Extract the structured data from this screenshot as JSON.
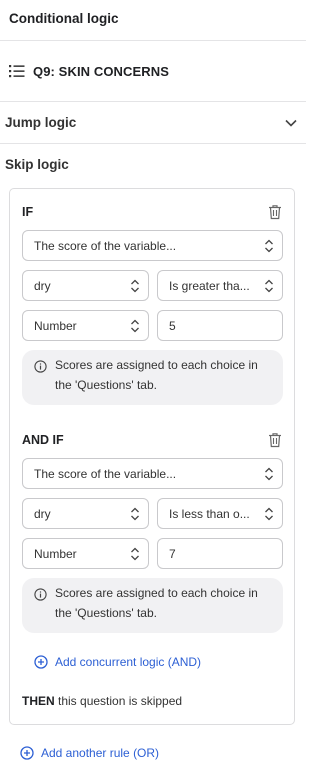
{
  "header": {
    "title": "Conditional logic"
  },
  "question": {
    "title": "Q9: SKIN CONCERNS",
    "icon": "list-icon"
  },
  "jump_logic": {
    "label": "Jump logic",
    "icon": "chevron-down-icon"
  },
  "skip_logic": {
    "label": "Skip logic",
    "rules": [
      {
        "heading": "IF",
        "condition_type": "The score of the variable...",
        "variable": "dry",
        "operator": "Is greater tha...",
        "value_type": "Number",
        "value": "5",
        "info": "Scores are assigned to each choice in the 'Questions' tab."
      },
      {
        "heading": "AND IF",
        "condition_type": "The score of the variable...",
        "variable": "dry",
        "operator": "Is less than o...",
        "value_type": "Number",
        "value": "7",
        "info": "Scores are assigned to each choice in the 'Questions' tab."
      }
    ],
    "add_concurrent": "Add concurrent logic (AND)",
    "then_keyword": "THEN",
    "then_text": " this question is skipped",
    "add_rule": "Add another rule (OR)"
  },
  "colors": {
    "accent": "#2c5fd4",
    "info_bg": "#f1f1f3",
    "border": "#c9c9cc"
  }
}
